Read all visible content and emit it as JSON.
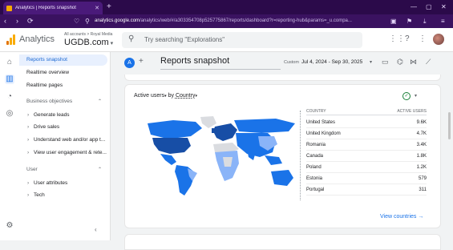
{
  "browser": {
    "tab_title": "Analytics | Reports snapshot",
    "url_domain": "analytics.google.com",
    "url_rest": "/analytics/web/#/a303354708p525775867/reports/dashboard?r=reporting-hub&params=_u.compa..."
  },
  "header": {
    "app_name": "Analytics",
    "account_crumb": "All accounts > Royal Media",
    "property_name": "UGDB.com",
    "search_placeholder": "Try searching \"Explorations\""
  },
  "nav": {
    "items_top": [
      "Reports snapshot",
      "Realtime overview",
      "Realtime pages"
    ],
    "section1_title": "Business objectives",
    "section1_items": [
      "Generate leads",
      "Drive sales",
      "Understand web and/or app t...",
      "View user engagement & rete..."
    ],
    "section2_title": "User",
    "section2_items": [
      "User attributes",
      "Tech"
    ]
  },
  "report": {
    "avatar_letter": "A",
    "title": "Reports snapshot",
    "custom_label": "Custom",
    "date_range": "Jul 4, 2024 - Sep 30, 2025"
  },
  "card": {
    "title_metric": "Active users",
    "title_by": " by ",
    "title_dim": "Country",
    "col_country": "COUNTRY",
    "col_users": "ACTIVE USERS",
    "rows": [
      {
        "country": "United States",
        "value": "9.6K"
      },
      {
        "country": "United Kingdom",
        "value": "4.7K"
      },
      {
        "country": "Romania",
        "value": "3.4K"
      },
      {
        "country": "Canada",
        "value": "1.8K"
      },
      {
        "country": "Poland",
        "value": "1.2K"
      },
      {
        "country": "Estonia",
        "value": "579"
      },
      {
        "country": "Portugal",
        "value": "311"
      }
    ],
    "view_link": "View countries"
  },
  "colors": {
    "accent": "#1a73e8",
    "browser_frame": "#2b0a4a",
    "map_dark": "#174ea6",
    "map_mid": "#1a73e8",
    "map_light": "#8ab4f8",
    "map_none": "#dadce0"
  }
}
